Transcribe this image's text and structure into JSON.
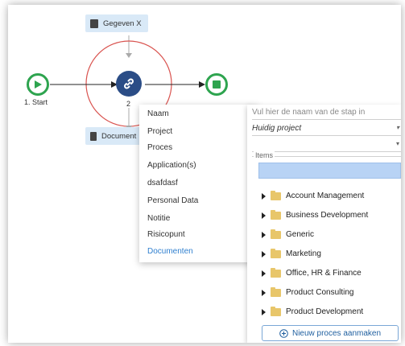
{
  "diagram": {
    "data_node_top": "Gegeven X",
    "data_node_bottom": "Document",
    "start_label": "1. Start",
    "step_number": "2"
  },
  "menu": {
    "items": [
      {
        "label": "Naam"
      },
      {
        "label": "Project"
      },
      {
        "label": "Proces"
      },
      {
        "label": "Application(s)"
      },
      {
        "label": "dsafdasf"
      },
      {
        "label": "Personal Data"
      },
      {
        "label": "Notitie"
      },
      {
        "label": "Risicopunt"
      },
      {
        "label": "Documenten"
      }
    ]
  },
  "panel": {
    "name_placeholder": "Vul hier de naam van de stap in",
    "project_value": "Huidig project",
    "items_label": "Items",
    "tree": [
      {
        "label": "Account Management"
      },
      {
        "label": "Business Development"
      },
      {
        "label": "Generic"
      },
      {
        "label": "Marketing"
      },
      {
        "label": "Office, HR & Finance"
      },
      {
        "label": "Product Consulting"
      },
      {
        "label": "Product Development"
      }
    ],
    "new_process_button": "Nieuw proces aanmaken"
  },
  "colors": {
    "accent": "#2f7fcf",
    "green": "#2ea44f",
    "red_ring": "#d9534f",
    "node_blue": "#d9e9f7",
    "selection": "#b8d3f5"
  }
}
